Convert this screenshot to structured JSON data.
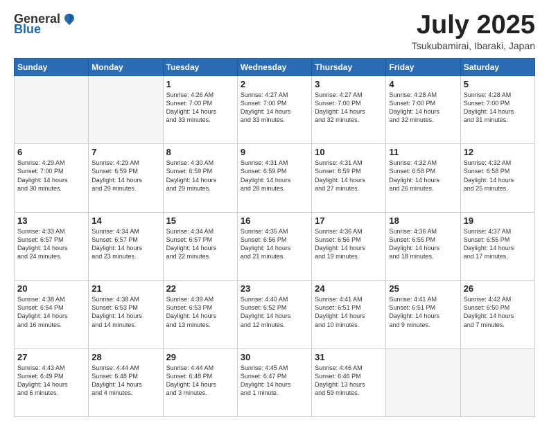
{
  "header": {
    "logo_general": "General",
    "logo_blue": "Blue",
    "month_title": "July 2025",
    "location": "Tsukubamirai, Ibaraki, Japan"
  },
  "weekdays": [
    "Sunday",
    "Monday",
    "Tuesday",
    "Wednesday",
    "Thursday",
    "Friday",
    "Saturday"
  ],
  "weeks": [
    [
      {
        "day": "",
        "info": ""
      },
      {
        "day": "",
        "info": ""
      },
      {
        "day": "1",
        "info": "Sunrise: 4:26 AM\nSunset: 7:00 PM\nDaylight: 14 hours\nand 33 minutes."
      },
      {
        "day": "2",
        "info": "Sunrise: 4:27 AM\nSunset: 7:00 PM\nDaylight: 14 hours\nand 33 minutes."
      },
      {
        "day": "3",
        "info": "Sunrise: 4:27 AM\nSunset: 7:00 PM\nDaylight: 14 hours\nand 32 minutes."
      },
      {
        "day": "4",
        "info": "Sunrise: 4:28 AM\nSunset: 7:00 PM\nDaylight: 14 hours\nand 32 minutes."
      },
      {
        "day": "5",
        "info": "Sunrise: 4:28 AM\nSunset: 7:00 PM\nDaylight: 14 hours\nand 31 minutes."
      }
    ],
    [
      {
        "day": "6",
        "info": "Sunrise: 4:29 AM\nSunset: 7:00 PM\nDaylight: 14 hours\nand 30 minutes."
      },
      {
        "day": "7",
        "info": "Sunrise: 4:29 AM\nSunset: 6:59 PM\nDaylight: 14 hours\nand 29 minutes."
      },
      {
        "day": "8",
        "info": "Sunrise: 4:30 AM\nSunset: 6:59 PM\nDaylight: 14 hours\nand 29 minutes."
      },
      {
        "day": "9",
        "info": "Sunrise: 4:31 AM\nSunset: 6:59 PM\nDaylight: 14 hours\nand 28 minutes."
      },
      {
        "day": "10",
        "info": "Sunrise: 4:31 AM\nSunset: 6:59 PM\nDaylight: 14 hours\nand 27 minutes."
      },
      {
        "day": "11",
        "info": "Sunrise: 4:32 AM\nSunset: 6:58 PM\nDaylight: 14 hours\nand 26 minutes."
      },
      {
        "day": "12",
        "info": "Sunrise: 4:32 AM\nSunset: 6:58 PM\nDaylight: 14 hours\nand 25 minutes."
      }
    ],
    [
      {
        "day": "13",
        "info": "Sunrise: 4:33 AM\nSunset: 6:57 PM\nDaylight: 14 hours\nand 24 minutes."
      },
      {
        "day": "14",
        "info": "Sunrise: 4:34 AM\nSunset: 6:57 PM\nDaylight: 14 hours\nand 23 minutes."
      },
      {
        "day": "15",
        "info": "Sunrise: 4:34 AM\nSunset: 6:57 PM\nDaylight: 14 hours\nand 22 minutes."
      },
      {
        "day": "16",
        "info": "Sunrise: 4:35 AM\nSunset: 6:56 PM\nDaylight: 14 hours\nand 21 minutes."
      },
      {
        "day": "17",
        "info": "Sunrise: 4:36 AM\nSunset: 6:56 PM\nDaylight: 14 hours\nand 19 minutes."
      },
      {
        "day": "18",
        "info": "Sunrise: 4:36 AM\nSunset: 6:55 PM\nDaylight: 14 hours\nand 18 minutes."
      },
      {
        "day": "19",
        "info": "Sunrise: 4:37 AM\nSunset: 6:55 PM\nDaylight: 14 hours\nand 17 minutes."
      }
    ],
    [
      {
        "day": "20",
        "info": "Sunrise: 4:38 AM\nSunset: 6:54 PM\nDaylight: 14 hours\nand 16 minutes."
      },
      {
        "day": "21",
        "info": "Sunrise: 4:38 AM\nSunset: 6:53 PM\nDaylight: 14 hours\nand 14 minutes."
      },
      {
        "day": "22",
        "info": "Sunrise: 4:39 AM\nSunset: 6:53 PM\nDaylight: 14 hours\nand 13 minutes."
      },
      {
        "day": "23",
        "info": "Sunrise: 4:40 AM\nSunset: 6:52 PM\nDaylight: 14 hours\nand 12 minutes."
      },
      {
        "day": "24",
        "info": "Sunrise: 4:41 AM\nSunset: 6:51 PM\nDaylight: 14 hours\nand 10 minutes."
      },
      {
        "day": "25",
        "info": "Sunrise: 4:41 AM\nSunset: 6:51 PM\nDaylight: 14 hours\nand 9 minutes."
      },
      {
        "day": "26",
        "info": "Sunrise: 4:42 AM\nSunset: 6:50 PM\nDaylight: 14 hours\nand 7 minutes."
      }
    ],
    [
      {
        "day": "27",
        "info": "Sunrise: 4:43 AM\nSunset: 6:49 PM\nDaylight: 14 hours\nand 6 minutes."
      },
      {
        "day": "28",
        "info": "Sunrise: 4:44 AM\nSunset: 6:48 PM\nDaylight: 14 hours\nand 4 minutes."
      },
      {
        "day": "29",
        "info": "Sunrise: 4:44 AM\nSunset: 6:48 PM\nDaylight: 14 hours\nand 3 minutes."
      },
      {
        "day": "30",
        "info": "Sunrise: 4:45 AM\nSunset: 6:47 PM\nDaylight: 14 hours\nand 1 minute."
      },
      {
        "day": "31",
        "info": "Sunrise: 4:46 AM\nSunset: 6:46 PM\nDaylight: 13 hours\nand 59 minutes."
      },
      {
        "day": "",
        "info": ""
      },
      {
        "day": "",
        "info": ""
      }
    ]
  ]
}
